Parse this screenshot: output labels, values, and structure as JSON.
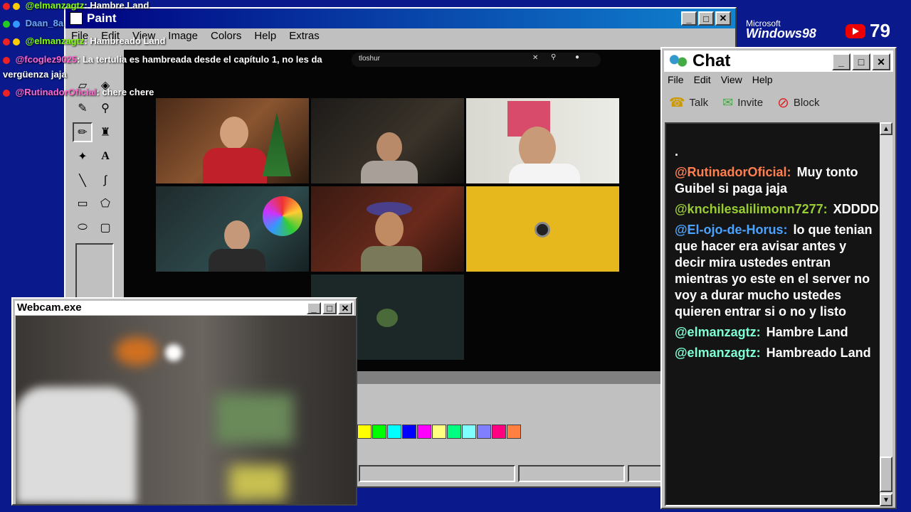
{
  "paint": {
    "title": "Paint",
    "menu": [
      "File",
      "Edit",
      "View",
      "Image",
      "Colors",
      "Help",
      "Extras"
    ],
    "window_controls": [
      "_",
      "□",
      "✕"
    ]
  },
  "stream": {
    "search_text": "tloshur",
    "search_clear": "✕"
  },
  "palette": [
    "#ffff00",
    "#00ff00",
    "#00ffff",
    "#0000ff",
    "#ff00ff",
    "#ffff80",
    "#00ff80",
    "#80ffff",
    "#8080ff",
    "#ff0080",
    "#ff8040"
  ],
  "webcam": {
    "title": "Webcam.exe",
    "window_controls": [
      "_",
      "□",
      "✕"
    ]
  },
  "chat": {
    "title": "Chat",
    "window_controls": [
      "_",
      "□",
      "✕"
    ],
    "menu": [
      "File",
      "Edit",
      "View",
      "Help"
    ],
    "toolbar": {
      "talk": "Talk",
      "invite": "Invite",
      "block": "Block"
    },
    "first_line": ".",
    "messages": [
      {
        "user": "@RutinadorOficial:",
        "color": "#ff7f50",
        "text": "Muy tonto Guibel si paga jaja"
      },
      {
        "user": "@knchilesalilimonn7277:",
        "color": "#9acd32",
        "text": "XDDDD"
      },
      {
        "user": "@El-ojo-de-Horus:",
        "color": "#4aa3ff",
        "text": "lo que tenian que hacer era avisar antes y decir mira ustedes entran mientras yo este en el server no voy a durar mucho ustedes quieren entrar si o no y listo"
      },
      {
        "user": "@elmanzagtz:",
        "color": "#7fffd4",
        "text": "Hambre Land"
      },
      {
        "user": "@elmanzagtz:",
        "color": "#7fffd4",
        "text": "Hambreado Land"
      }
    ]
  },
  "overlay_chat": [
    {
      "user": "@elmanzagtz",
      "color": "#7fff00",
      "text": ": Hambre Land"
    },
    {
      "user": "Daan_8a",
      "color": "#6aa8ff",
      "text": ""
    },
    {
      "user": "@elmanzagtz",
      "color": "#7fff00",
      "text": ": Hambreado Land"
    },
    {
      "user": "@fcoglez9025",
      "color": "#ff66cc",
      "text": ": La tertulia es hambreada desde el capítulo 1, no les da"
    },
    {
      "user": "",
      "color": "#ffffff",
      "text": "vergüenza jaja"
    },
    {
      "user": "@RutinadorOficial",
      "color": "#ff66cc",
      "text": ": chere chere"
    }
  ],
  "branding": {
    "ms": "Microsoft",
    "win": "Windows98",
    "viewers": "79"
  },
  "colors": {
    "title_gradient_start": "#000080",
    "title_gradient_end": "#1084d0",
    "desktop": "#0a1a8c",
    "tile_yellow": "#e6b81e"
  }
}
